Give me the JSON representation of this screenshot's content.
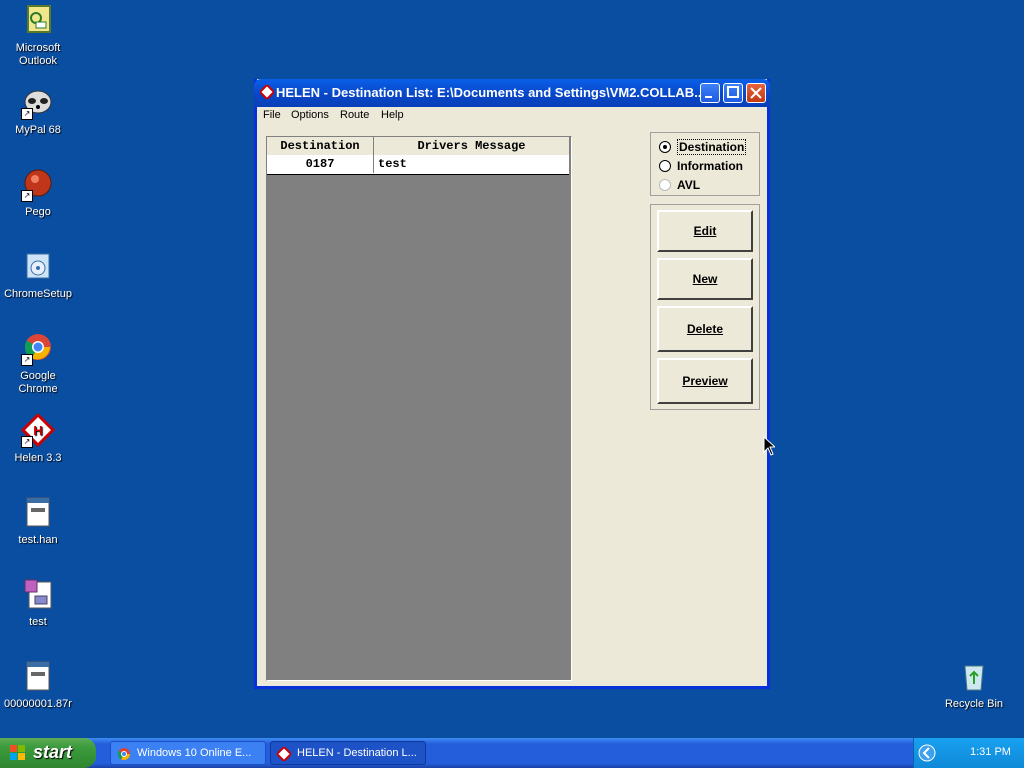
{
  "desktop": {
    "icons": [
      {
        "label": "Microsoft Outlook"
      },
      {
        "label": "MyPal 68"
      },
      {
        "label": "Pego"
      },
      {
        "label": "ChromeSetup"
      },
      {
        "label": "Google Chrome"
      },
      {
        "label": "Helen 3.3"
      },
      {
        "label": "test.han"
      },
      {
        "label": "test"
      },
      {
        "label": "00000001.87r"
      },
      {
        "label": "Recycle Bin"
      }
    ]
  },
  "window": {
    "title": "HELEN - Destination List: E:\\Documents and Settings\\VM2.COLLAB...",
    "menu": [
      "File",
      "Options",
      "Route",
      "Help"
    ],
    "table": {
      "headers": [
        "Destination",
        "Drivers Message"
      ],
      "rows": [
        [
          "0187",
          "test"
        ]
      ]
    },
    "radio_options": [
      {
        "label": "Destination",
        "selected": true
      },
      {
        "label": "Information",
        "selected": false
      },
      {
        "label": "AVL",
        "selected": false
      }
    ],
    "buttons": [
      "Edit",
      "New",
      "Delete",
      "Preview"
    ]
  },
  "taskbar": {
    "start_label": "start",
    "tasks": [
      {
        "label": "Windows 10 Online E..."
      },
      {
        "label": "HELEN - Destination L..."
      }
    ],
    "clock": "1:31 PM"
  }
}
